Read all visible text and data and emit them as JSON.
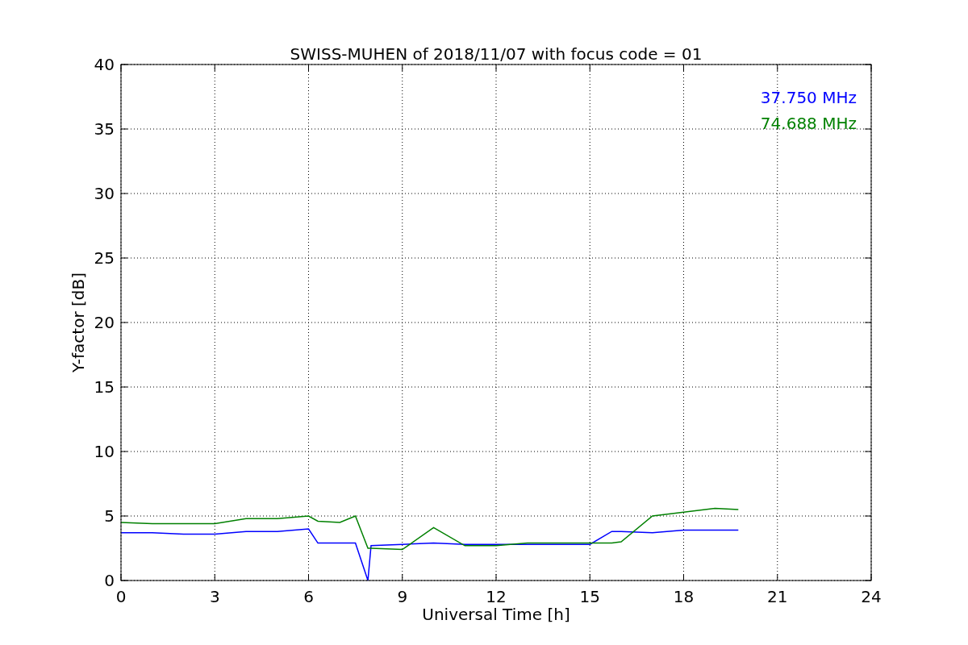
{
  "figure": {
    "chart_data": {
      "type": "line",
      "title": "SWISS-MUHEN of 2018/11/07 with focus code = 01",
      "xlabel": "Universal Time [h]",
      "ylabel": "Y-factor [dB]",
      "x": [
        0,
        1,
        2,
        3,
        4,
        5,
        6,
        6.3,
        7,
        7.5,
        7.9,
        8,
        9,
        10,
        11,
        12,
        13,
        14,
        15,
        15.7,
        16,
        17,
        18,
        19,
        19.75
      ],
      "series": [
        {
          "name": "37.750 MHz",
          "color": "#0000ff",
          "values": [
            3.7,
            3.7,
            3.6,
            3.6,
            3.8,
            3.8,
            4.0,
            2.9,
            2.9,
            2.9,
            0,
            2.7,
            2.8,
            2.9,
            2.8,
            2.8,
            2.8,
            2.8,
            2.8,
            3.8,
            3.8,
            3.7,
            3.9,
            3.9,
            3.9
          ]
        },
        {
          "name": "74.688 MHz",
          "color": "#008000",
          "values": [
            4.5,
            4.4,
            4.4,
            4.4,
            4.8,
            4.8,
            5.0,
            4.6,
            4.5,
            5.0,
            2.5,
            2.5,
            2.4,
            4.1,
            2.7,
            2.7,
            2.9,
            2.9,
            2.9,
            2.9,
            3.0,
            5.0,
            5.3,
            5.6,
            5.5
          ]
        }
      ],
      "xlim": [
        0,
        24
      ],
      "ylim": [
        0,
        40
      ],
      "xticks": [
        0,
        3,
        6,
        9,
        12,
        15,
        18,
        21,
        24
      ],
      "yticks": [
        0,
        5,
        10,
        15,
        20,
        25,
        30,
        35,
        40
      ],
      "grid": true
    }
  }
}
